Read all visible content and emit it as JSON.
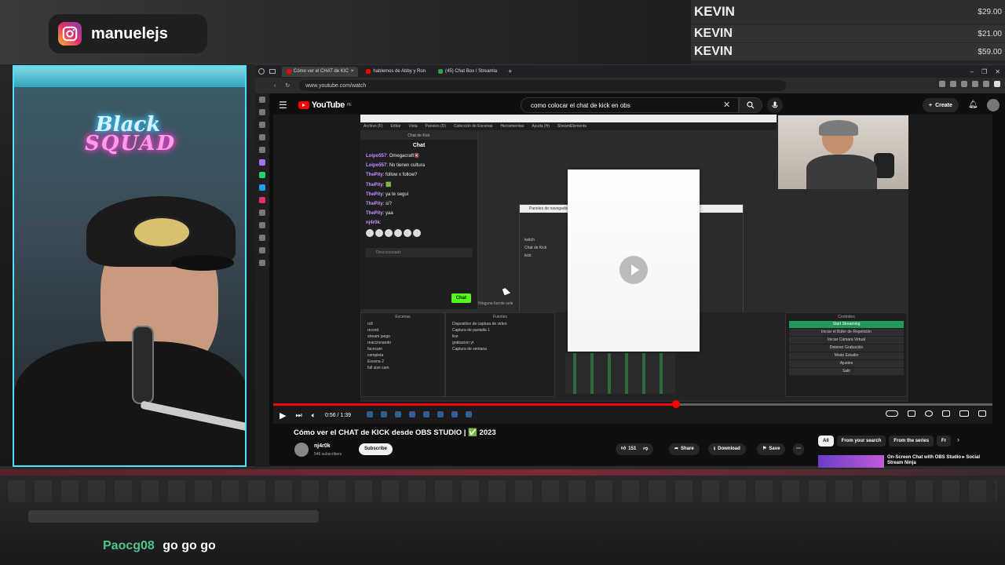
{
  "overlay": {
    "instagram_handle": "manuelejs",
    "donations": [
      {
        "name": "KEVIN",
        "amount": "$29.00"
      },
      {
        "name": "KEVIN",
        "amount": "$21.00"
      },
      {
        "name": "KEVIN",
        "amount": "$59.00"
      }
    ],
    "webcam_sign": {
      "line1": "Black",
      "line2": "SQUAD"
    },
    "chat": {
      "user": "Paocg08",
      "message": "go go go"
    }
  },
  "browser": {
    "tabs": [
      {
        "label": "Cómo ver el CHAT de KIC",
        "active": true
      },
      {
        "label": "hablemos de Abby y Ron",
        "active": false
      },
      {
        "label": "(45) Chat Box / Streamla",
        "active": false
      }
    ],
    "url": "www.youtube.com/watch"
  },
  "youtube": {
    "logo_text": "YouTube",
    "logo_region": "PE",
    "search_query": "como colocar el chat de kick en obs",
    "create_label": "Create",
    "video": {
      "title": "Cómo ver el CHAT de KICK desde OBS STUDIO | ✅ 2023",
      "time": "0:56 / 1:39",
      "progress": 0.56
    },
    "channel": {
      "name": "nj4r0k",
      "subscribers": "546 subscribers"
    },
    "subscribe_label": "Subscribe",
    "actions": {
      "likes": "151",
      "share": "Share",
      "download": "Download",
      "save": "Save"
    },
    "chips": [
      "All",
      "From your search",
      "From the series",
      "Fr"
    ],
    "rec_title": "On-Screen Chat with OBS Studio ▸ Social Stream Ninja"
  },
  "obs": {
    "menu": [
      "Archivo (F)",
      "Editar",
      "Vista",
      "Paneles (D)",
      "Colección de Escenas",
      "Herramientas",
      "Ayuda (H)",
      "StreamElements"
    ],
    "kick_dock": {
      "title": "Chat de Kick",
      "header": "Chat",
      "messages": [
        {
          "user": "Loipo557",
          "text": "Omegacraft🔇"
        },
        {
          "user": "Loipo557",
          "text": "No tienen cultura"
        },
        {
          "user": "ThePity",
          "text": "follow x follow?"
        },
        {
          "user": "ThePity",
          "text": "🟩"
        },
        {
          "user": "ThePity",
          "text": "ya te seguí"
        },
        {
          "user": "ThePity",
          "text": "sí?"
        },
        {
          "user": "ThePity",
          "text": "yaa"
        },
        {
          "user": "nj4r0k",
          "text": ""
        }
      ],
      "status": "Desconectado",
      "send_label": "Chat"
    },
    "nav_dialog": {
      "title": "Paneles de navegador",
      "rows": [
        "twitch",
        "Chat de Kick",
        "kick"
      ]
    },
    "scenes_title": "Escenas",
    "scenes": [
      "roll",
      "record",
      "stream juego",
      "reaccionando",
      "facecam",
      "completa",
      "Escena 2",
      "full size cam"
    ],
    "sources_title": "Fuentes",
    "sources": [
      "Dispositivo de captura de video",
      "Captura de pantalla 1",
      "live",
      "grabacion yt",
      "Captura de ventana"
    ],
    "controls_title": "Controles",
    "controls": [
      "Start Streaming",
      "Iniciar el Búfer de Repetición",
      "Iniciar Cámara Virtual",
      "Detener Grabación",
      "Modo Estudio",
      "Ajustes",
      "Salir"
    ],
    "no_source": "Ninguna fuente sele"
  }
}
